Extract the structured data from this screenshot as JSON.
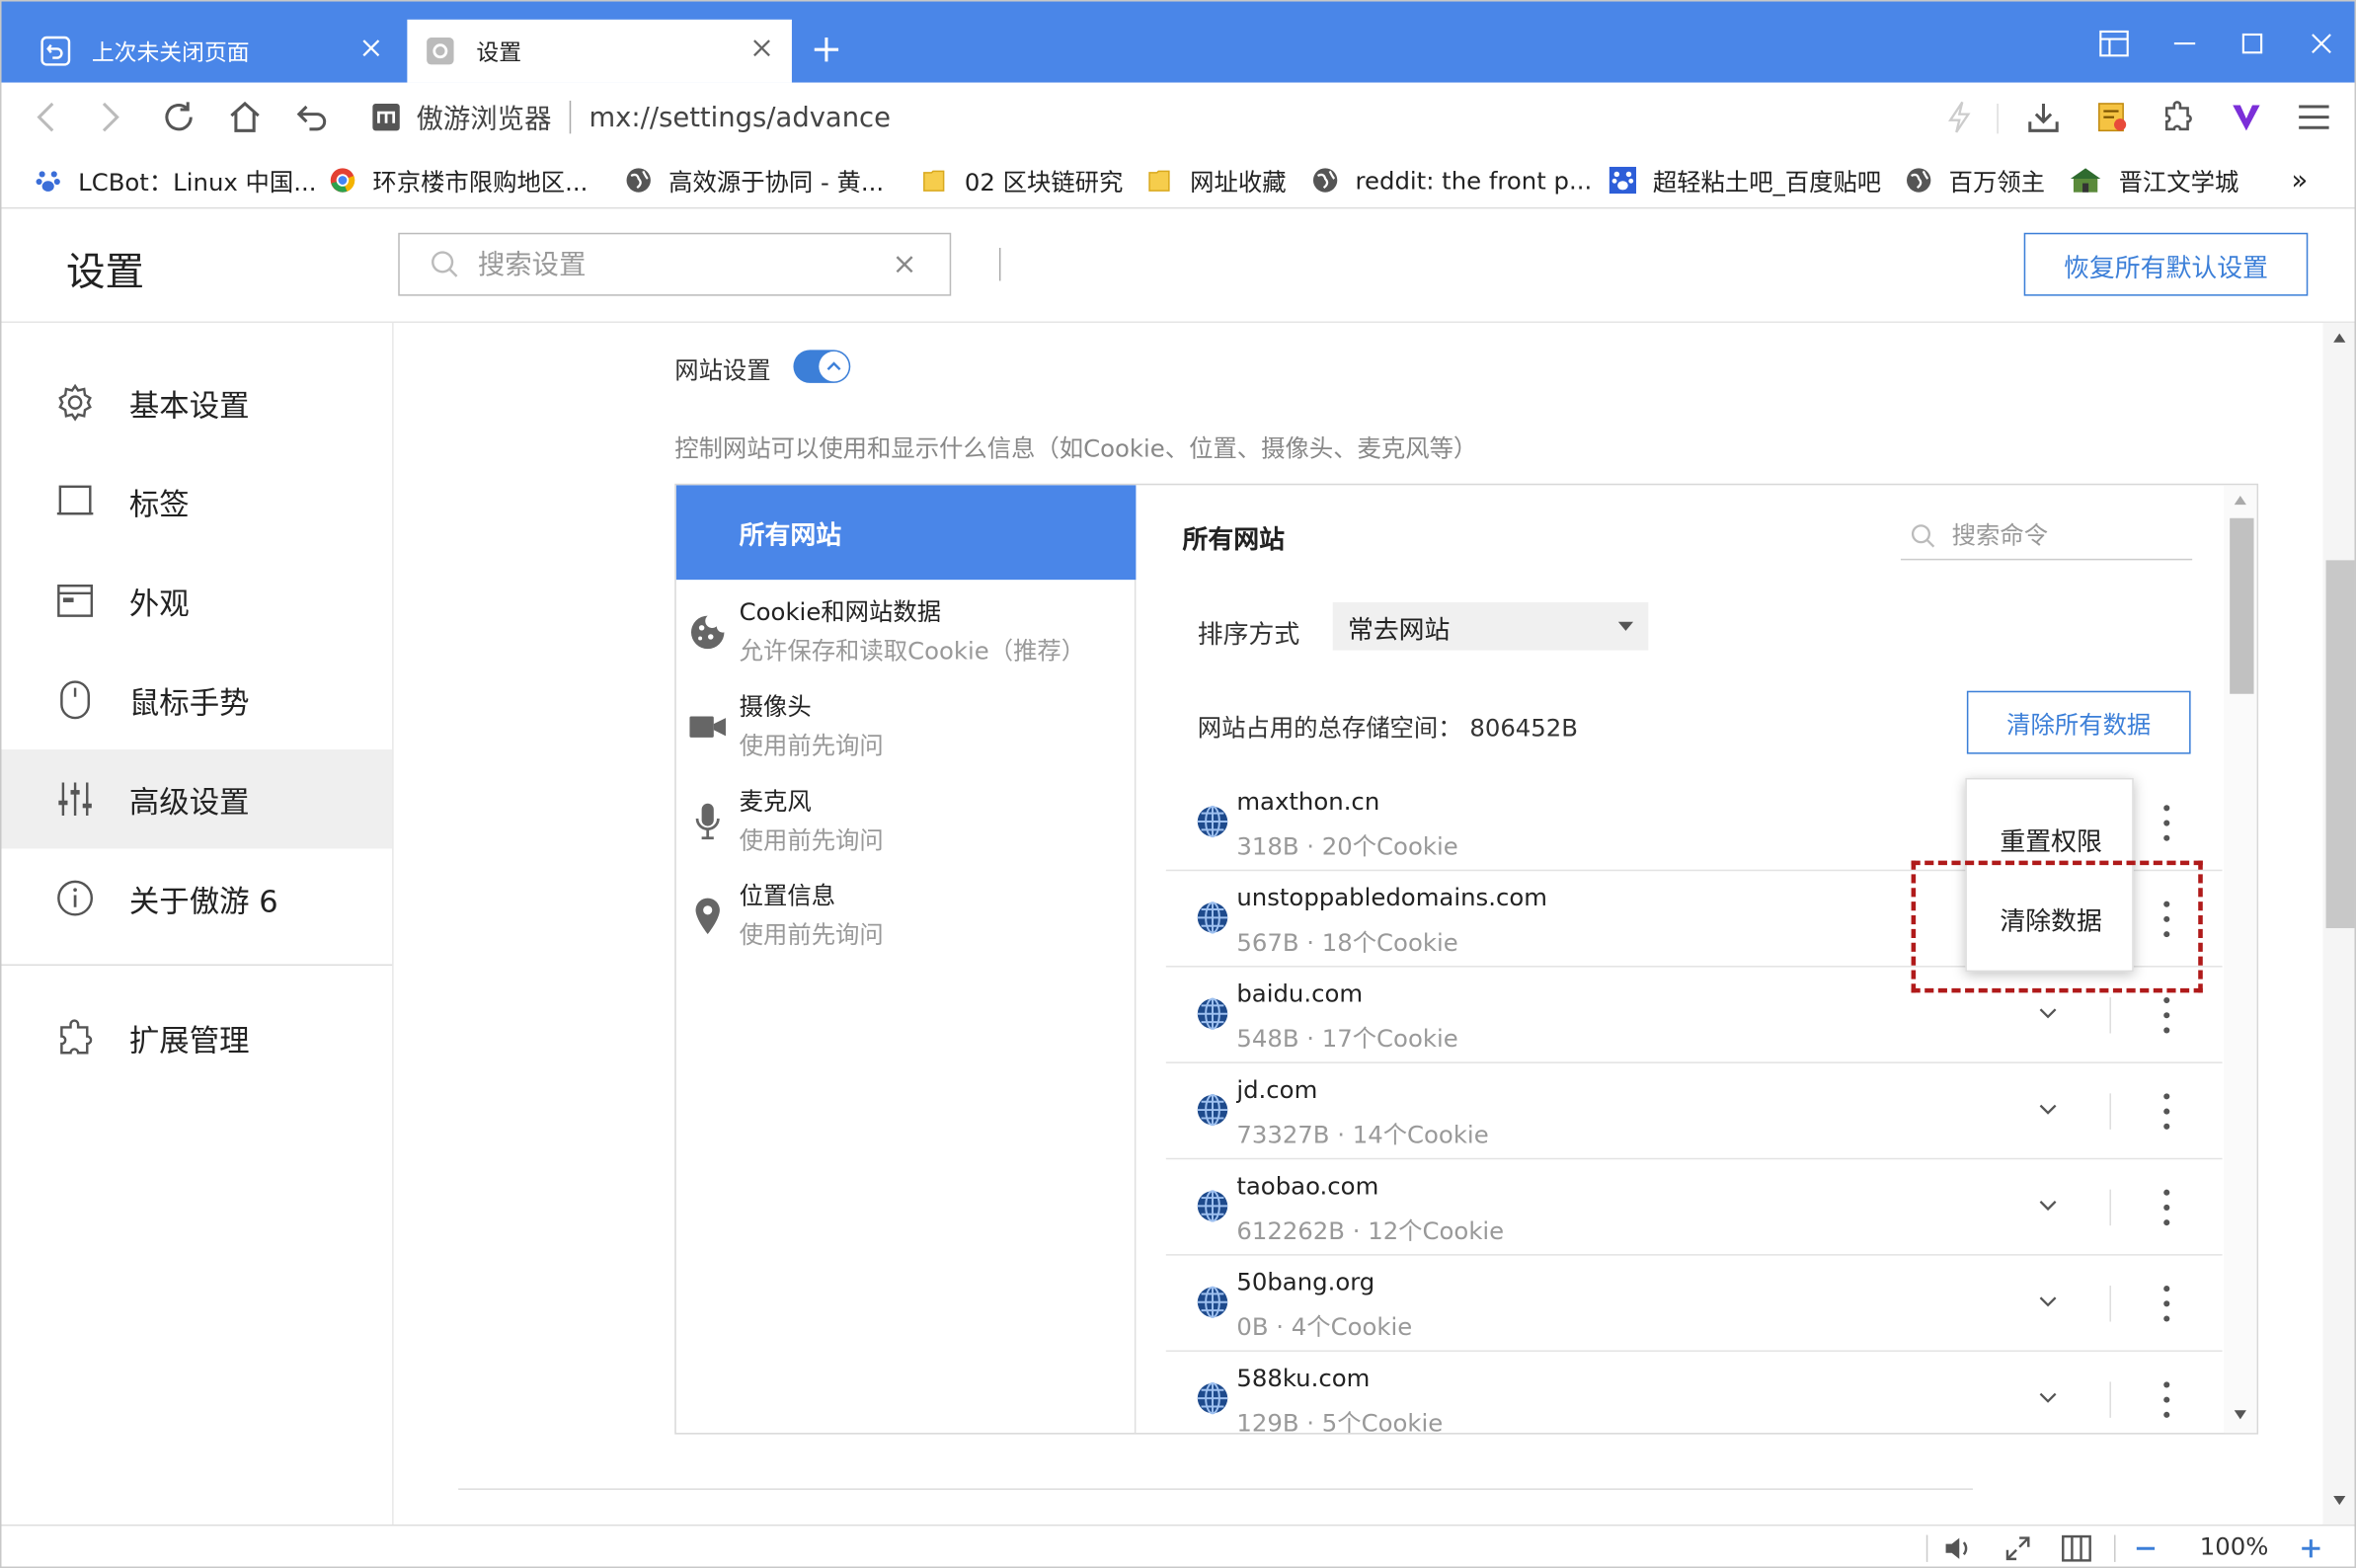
{
  "tabs": [
    {
      "title": "上次未关闭页面"
    },
    {
      "title": "设置"
    }
  ],
  "address": {
    "site_name": "傲游浏览器",
    "url": "mx://settings/advance"
  },
  "bookmarks": [
    {
      "label": "LCBot：Linux 中国...",
      "icon": "paw-icon"
    },
    {
      "label": "环京楼市限购地区...",
      "icon": "chrome-icon"
    },
    {
      "label": "高效源于协同 - 黄...",
      "icon": "globe-icon"
    },
    {
      "label": "02 区块链研究",
      "icon": "folder-icon"
    },
    {
      "label": "网址收藏",
      "icon": "folder-icon"
    },
    {
      "label": "reddit: the front p...",
      "icon": "globe-icon"
    },
    {
      "label": "超轻粘土吧_百度贴吧",
      "icon": "paw-icon"
    },
    {
      "label": "百万领主",
      "icon": "globe-icon"
    },
    {
      "label": "晋江文学城",
      "icon": "house-icon"
    }
  ],
  "bookmarks_more": "»",
  "settings": {
    "title": "设置",
    "search_placeholder": "搜索设置",
    "restore_label": "恢复所有默认设置"
  },
  "sidebar": {
    "items": [
      {
        "label": "基本设置",
        "icon": "gear-icon"
      },
      {
        "label": "标签",
        "icon": "tab-icon"
      },
      {
        "label": "外观",
        "icon": "window-icon"
      },
      {
        "label": "鼠标手势",
        "icon": "mouse-icon"
      },
      {
        "label": "高级设置",
        "icon": "sliders-icon"
      },
      {
        "label": "关于傲游 6",
        "icon": "info-icon"
      },
      {
        "label": "扩展管理",
        "icon": "puzzle-icon"
      }
    ]
  },
  "site_settings": {
    "label": "网站设置",
    "desc": "控制网站可以使用和显示什么信息（如Cookie、位置、摄像头、麦克风等）",
    "left_header": "所有网站",
    "left_items": [
      {
        "title": "Cookie和网站数据",
        "sub": "允许保存和读取Cookie（推荐）",
        "icon": "cookie-icon"
      },
      {
        "title": "摄像头",
        "sub": "使用前先询问",
        "icon": "camera-icon"
      },
      {
        "title": "麦克风",
        "sub": "使用前先询问",
        "icon": "microphone-icon"
      },
      {
        "title": "位置信息",
        "sub": "使用前先询问",
        "icon": "location-icon"
      }
    ],
    "right_title": "所有网站",
    "search_placeholder": "搜索命令",
    "sort_label": "排序方式",
    "sort_value": "常去网站",
    "storage_label": "网站占用的总存储空间：  806452B",
    "clear_all": "清除所有数据",
    "sites": [
      {
        "name": "maxthon.cn",
        "meta": "318B · 20个Cookie"
      },
      {
        "name": "unstoppabledomains.com",
        "meta": "567B · 18个Cookie"
      },
      {
        "name": "baidu.com",
        "meta": "548B · 17个Cookie"
      },
      {
        "name": "jd.com",
        "meta": "73327B · 14个Cookie"
      },
      {
        "name": "taobao.com",
        "meta": "612262B · 12个Cookie"
      },
      {
        "name": "50bang.org",
        "meta": "0B · 4个Cookie"
      },
      {
        "name": "588ku.com",
        "meta": "129B · 5个Cookie"
      }
    ],
    "popup": {
      "reset": "重置权限",
      "clear": "清除数据"
    }
  },
  "status": {
    "zoom": "100%"
  },
  "colors": {
    "accent": "#4a86e8",
    "link": "#3c7fd8",
    "highlight": "#b01a1a"
  }
}
